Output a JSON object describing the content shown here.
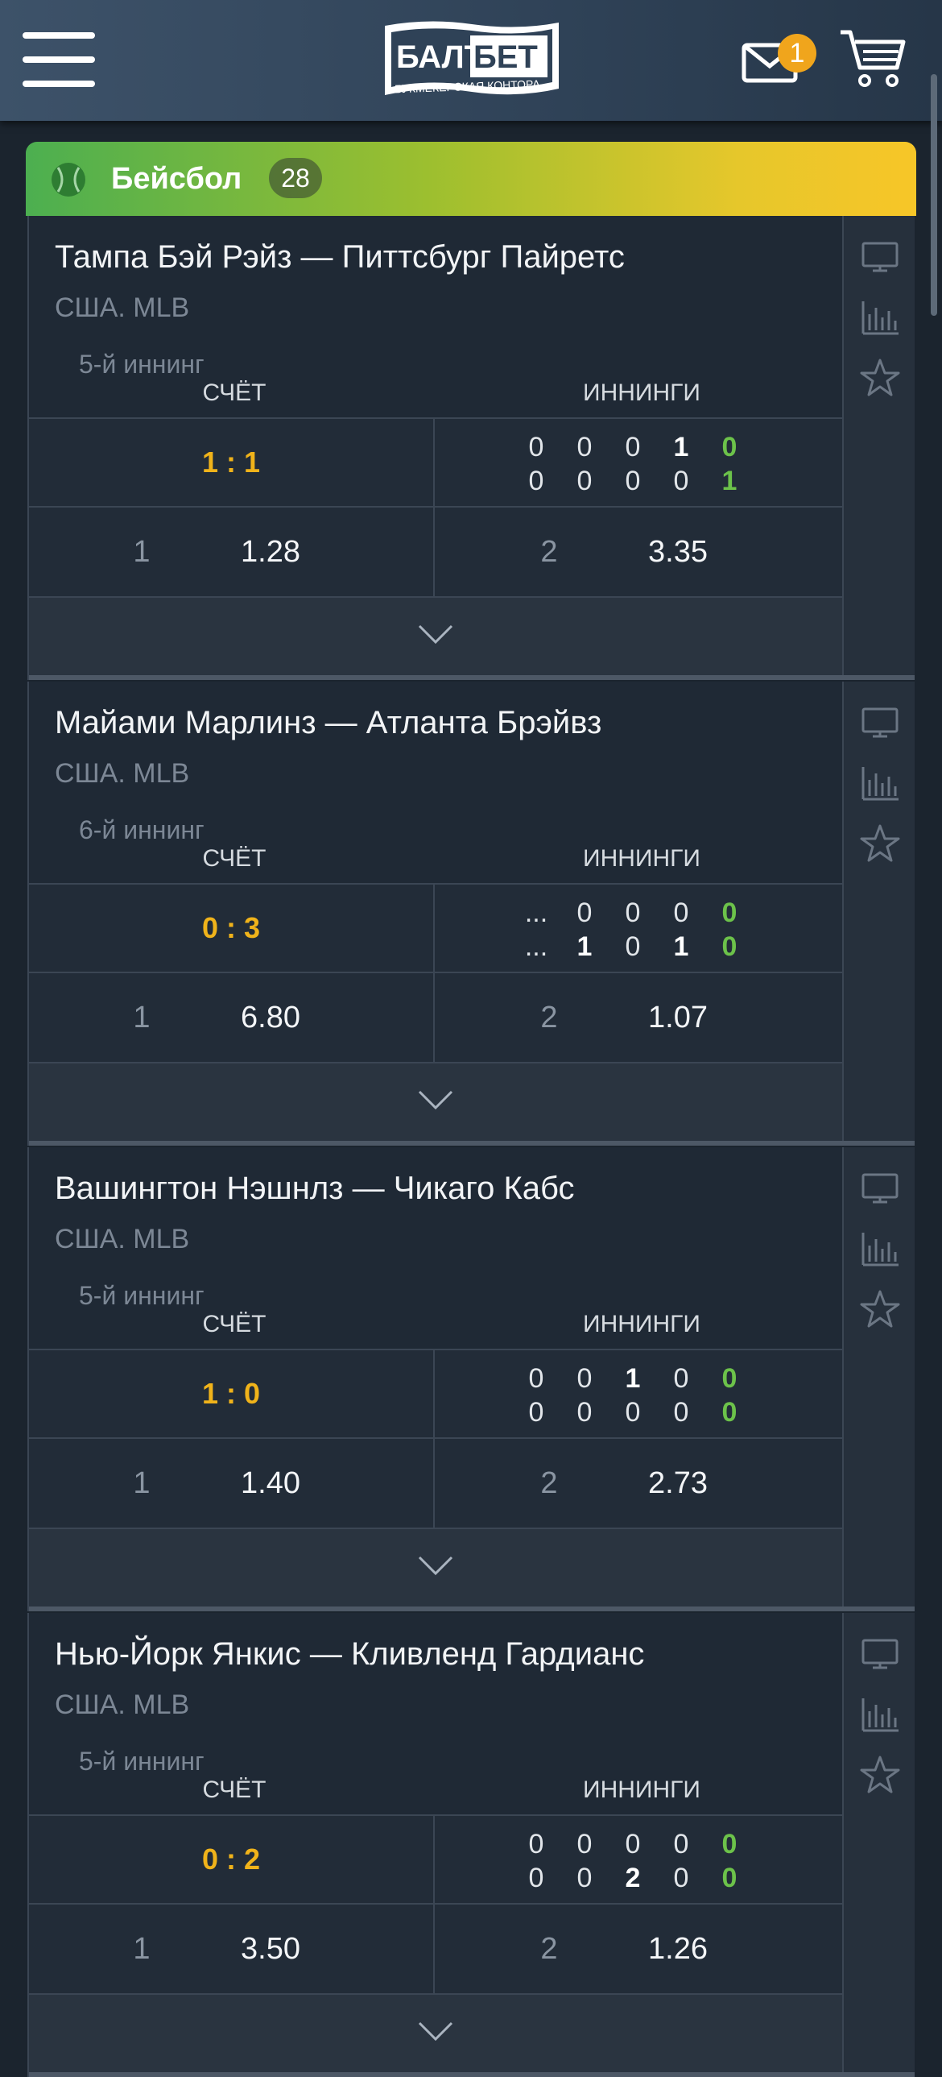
{
  "header": {
    "menu_icon": "hamburger-menu-icon",
    "logo_top": "БАЛТБЕТ",
    "logo_sub": "БУКМЕКЕРСКАЯ КОНТОРА",
    "mail_badge": "1",
    "cart_icon": "cart-icon"
  },
  "sport": {
    "title": "Бейсбол",
    "count": "28",
    "icon": "baseball-icon"
  },
  "labels": {
    "score": "СЧЁТ",
    "innings": "ИННИНГИ"
  },
  "events": [
    {
      "teams": "Тампа Бэй Рэйз — Питтсбург Пайретс",
      "league": "США. MLB",
      "period": "5-й иннинг",
      "score": "1 : 1",
      "innings_top": [
        "0",
        "0",
        "0",
        "1",
        "0"
      ],
      "innings_bottom": [
        "0",
        "0",
        "0",
        "0",
        "1"
      ],
      "odd1_label": "1",
      "odd1": "1.28",
      "odd2_label": "2",
      "odd2": "3.35"
    },
    {
      "teams": "Майами Марлинз — Атланта Брэйвз",
      "league": "США. MLB",
      "period": "6-й иннинг",
      "score": "0 : 3",
      "innings_top": [
        "...",
        "0",
        "0",
        "0",
        "0"
      ],
      "innings_bottom": [
        "...",
        "1",
        "0",
        "1",
        "0"
      ],
      "odd1_label": "1",
      "odd1": "6.80",
      "odd2_label": "2",
      "odd2": "1.07"
    },
    {
      "teams": "Вашингтон Нэшнлз — Чикаго Кабс",
      "league": "США. MLB",
      "period": "5-й иннинг",
      "score": "1 : 0",
      "innings_top": [
        "0",
        "0",
        "1",
        "0",
        "0"
      ],
      "innings_bottom": [
        "0",
        "0",
        "0",
        "0",
        "0"
      ],
      "odd1_label": "1",
      "odd1": "1.40",
      "odd2_label": "2",
      "odd2": "2.73"
    },
    {
      "teams": "Нью-Йорк Янкис — Кливленд Гардианс",
      "league": "США. MLB",
      "period": "5-й иннинг",
      "score": "0 : 2",
      "innings_top": [
        "0",
        "0",
        "0",
        "0",
        "0"
      ],
      "innings_bottom": [
        "0",
        "0",
        "2",
        "0",
        "0"
      ],
      "odd1_label": "1",
      "odd1": "3.50",
      "odd2_label": "2",
      "odd2": "1.26"
    }
  ],
  "colors": {
    "accent_score": "#f0b31a",
    "inning_green": "#6cc24a",
    "badge": "#f0a51c"
  }
}
